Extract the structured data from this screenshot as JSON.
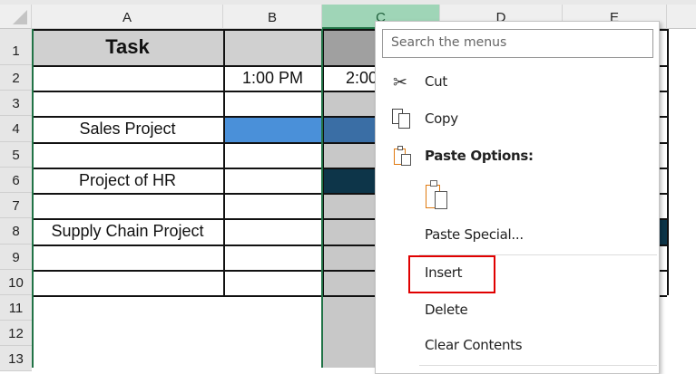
{
  "columns": [
    "A",
    "B",
    "C",
    "D",
    "E"
  ],
  "rows": [
    "1",
    "2",
    "3",
    "4",
    "5",
    "6",
    "7",
    "8",
    "9",
    "10",
    "11",
    "12",
    "13"
  ],
  "cells": {
    "a1": "Task",
    "b2": "1:00 PM",
    "c2": "2:00 PM",
    "a4": "Sales Project",
    "a6": "Project of HR",
    "a8": "Supply Chain Project"
  },
  "menu": {
    "search_placeholder": "Search the menus",
    "cut": "Cut",
    "copy": "Copy",
    "paste_options": "Paste Options:",
    "paste_special": "Paste Special...",
    "insert": "Insert",
    "delete": "Delete",
    "clear_contents": "Clear Contents"
  },
  "colors": {
    "selection": "#217346",
    "highlight_box": "#e00000",
    "sales_bar_b": "#4a90d9",
    "sales_bar_c": "#3a6ea5",
    "hr_bar": "#0d3549"
  }
}
